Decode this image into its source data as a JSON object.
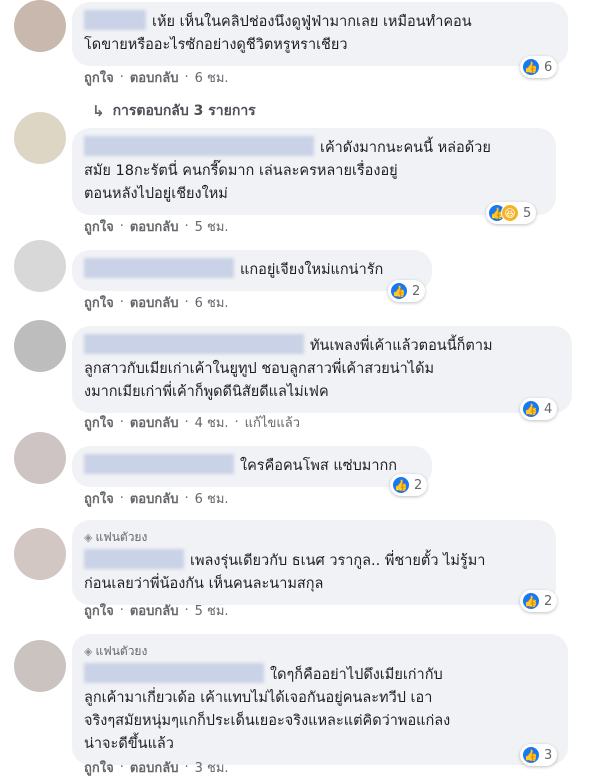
{
  "comments": [
    {
      "text_lines": [
        "เห้ย เห็นในคลิปช่องนึงดูฟู่ฟ่ามากเลย เหมือนทำคอน",
        "โดขายหรืออะไรซักอย่างดูชีวิตหรูหราเชียว"
      ],
      "like": "ถูกใจ",
      "reply": "ตอบกลับ",
      "time": "6 ชม.",
      "reaction_count": "6",
      "avatar_color": "#c8b8ad"
    },
    {
      "text_lines": [
        "เค้าดังมากนะคนนี้ หล่อด้วย",
        "สมัย 18กะรัตนี่ คนกรี๊ดมาก เล่นละครหลายเรื่องอยู่",
        "ตอนหลังไปอยู่เชียงใหม่"
      ],
      "like": "ถูกใจ",
      "reply": "ตอบกลับ",
      "time": "5 ชม.",
      "reaction_count": "5",
      "avatar_color": "#ddd6c5"
    },
    {
      "text_lines": [
        "แกอยู่เจียงใหม่แกน่ารัก"
      ],
      "like": "ถูกใจ",
      "reply": "ตอบกลับ",
      "time": "6 ชม.",
      "reaction_count": "2",
      "avatar_color": "#d8d8d8"
    },
    {
      "text_lines": [
        "ทันเพลงพี่เค้าแล้วตอนนี้ก็ตาม",
        "ลูกสาวกับเมียเก่าเค้าในยูทูป ชอบลูกสาวพี่เค้าสวยน่าได้ม",
        "งมากเมียเก่าพี่เค้าก็พูดดีนิสัยดีแลไม่เฟค"
      ],
      "like": "ถูกใจ",
      "reply": "ตอบกลับ",
      "time": "4 ชม.",
      "edited": "แก้ไขแล้ว",
      "reaction_count": "4",
      "avatar_color": "#bdbdbd"
    },
    {
      "text_lines": [
        "ใครคือคนโพส แซ่บมากก"
      ],
      "like": "ถูกใจ",
      "reply": "ตอบกลับ",
      "time": "6 ชม.",
      "reaction_count": "2",
      "avatar_color": "#cfc4c4"
    },
    {
      "badge": "แฟนตัวยง",
      "text_lines": [
        "เพลงรุ่นเดียวกับ ธเนศ วรากูล.. พี่ชายตั้ว ไม่รู้มา",
        "ก่อนเลยว่าพี่น้องกัน เห็นคนละนามสกุล"
      ],
      "like": "ถูกใจ",
      "reply": "ตอบกลับ",
      "time": "5 ชม.",
      "reaction_count": "2",
      "avatar_color": "#d2c7c2"
    },
    {
      "badge": "แฟนตัวยง",
      "text_lines": [
        "ใดๆก็คืออย่าไปดึงเมียเก่ากับ",
        "ลูกเค้ามาเกี่ยวเด้อ เค้าแทบไม่ได้เจอกันอยู่คนละทวีป เอา",
        "จริงๆสมัยหนุ่มๆแกก็ประเด็นเยอะจริงแหละแต่คิดว่าพอแก่ลง",
        "น่าจะดีขึ้นแล้ว"
      ],
      "like": "ถูกใจ",
      "reply": "ตอบกลับ",
      "time": "3 ชม.",
      "reaction_count": "3",
      "avatar_color": "#cbc3c0"
    }
  ],
  "replies_link": "การตอบกลับ 3 รายการ",
  "colors": {
    "like_blue": "#1877f2",
    "haha_yellow": "#f7b125",
    "bubble": "#f0f2f5",
    "meta_gray": "#65676b"
  },
  "icons": {
    "like": "thumbs-up-icon",
    "haha": "haha-icon",
    "reply_arrow": "reply-arrow-icon",
    "badge": "diamond-icon"
  }
}
